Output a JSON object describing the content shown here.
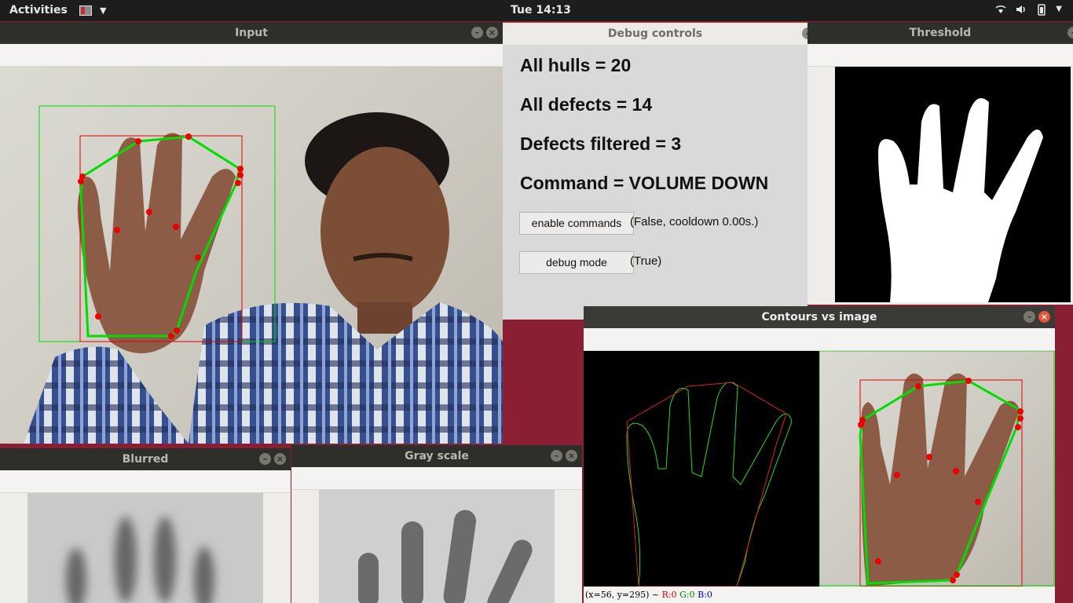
{
  "topbar": {
    "activities": "Activities",
    "clock": "Tue 14:13",
    "caret": "▼",
    "tray_icons": [
      "wifi-icon",
      "volume-icon",
      "battery-icon"
    ]
  },
  "windows": {
    "input": {
      "title": "Input"
    },
    "debug": {
      "title": "Debug controls",
      "lines": [
        "All hulls = 20",
        "All defects = 14",
        "Defects filtered = 3",
        "Command = VOLUME DOWN"
      ],
      "enable_button": "enable commands",
      "enable_status": "(False, cooldown 0.00s.)",
      "debug_button": "debug mode",
      "debug_status": "(True)"
    },
    "threshold": {
      "title": "Threshold"
    },
    "contours": {
      "title": "Contours vs image",
      "status_prefix": "(x=56, y=295) ~ ",
      "status_r": "R:0",
      "status_g": "G:0",
      "status_b": "B:0"
    },
    "blurred": {
      "title": "Blurred"
    },
    "grayscale": {
      "title": "Gray scale"
    }
  },
  "colors": {
    "desktop": "#8a1f33",
    "hull_green": "#00dd00",
    "rect_red": "#dd0000",
    "defect_red": "#ee0000"
  }
}
